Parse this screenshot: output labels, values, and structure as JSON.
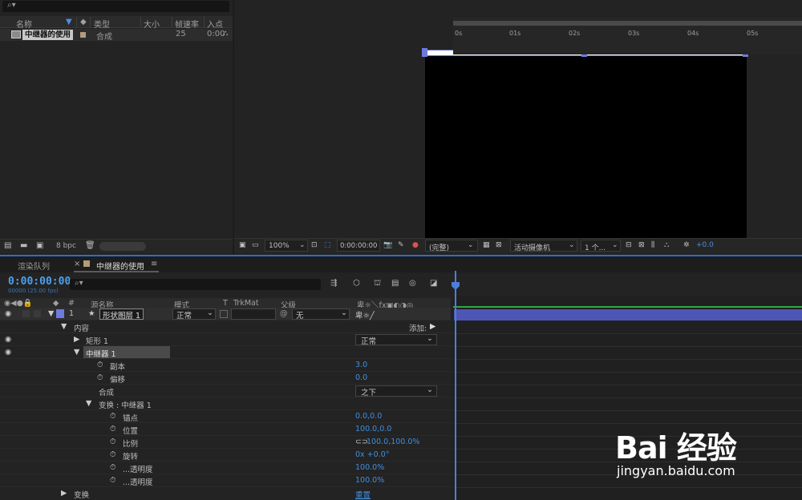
{
  "project": {
    "columns": [
      "名称",
      "类型",
      "大小",
      "帧速率",
      "入点"
    ],
    "item": {
      "name": "中继器的使用",
      "type": "合成",
      "rate": "25",
      "in": "0:00"
    },
    "bpc": "8 bpc"
  },
  "viewer": {
    "zoom": "100%",
    "timecode": "0:00:00:00",
    "resolution": "(完整)",
    "camera": "活动摄像机",
    "views": "1 个...",
    "exposure": "+0.0"
  },
  "timeline": {
    "tab_render": "渲染队列",
    "tab_comp": "中继器的使用",
    "timecode": "0:00:00:00",
    "fps": "00000 (25.00 fps)",
    "columns": {
      "source": "源名称",
      "mode": "模式",
      "t": "T",
      "trkmat": "TrkMat",
      "parent": "父级"
    },
    "layer": {
      "index": "1",
      "name": "形状图层 1",
      "mode": "正常",
      "parent": "无"
    },
    "rows": {
      "content": "内容",
      "add": "添加:",
      "rect": "矩形 1",
      "rect_mode": "正常",
      "repeater": "中继器 1",
      "copies_label": "副本",
      "copies_val": "3.0",
      "offset_label": "偏移",
      "offset_val": "0.0",
      "composite_label": "合成",
      "composite_val": "之下",
      "transform_rep": "变换 : 中继器 1",
      "anchor_label": "锚点",
      "anchor_val": "0.0,0.0",
      "position_label": "位置",
      "position_val": "100.0,0.0",
      "scale_label": "比例",
      "scale_val": "100.0,100.0%",
      "rotation_label": "旋转",
      "rotation_val": "0x +0.0°",
      "start_opacity_label": "...透明度",
      "start_opacity_val": "100.0%",
      "end_opacity_label": "...透明度",
      "end_opacity_val": "100.0%",
      "transform": "变换",
      "reset": "重置"
    },
    "ruler": [
      "0s",
      "01s",
      "02s",
      "03s",
      "04s",
      "05s"
    ]
  },
  "watermark": {
    "logo": "Bai 经验",
    "url": "jingyan.baidu.com"
  }
}
